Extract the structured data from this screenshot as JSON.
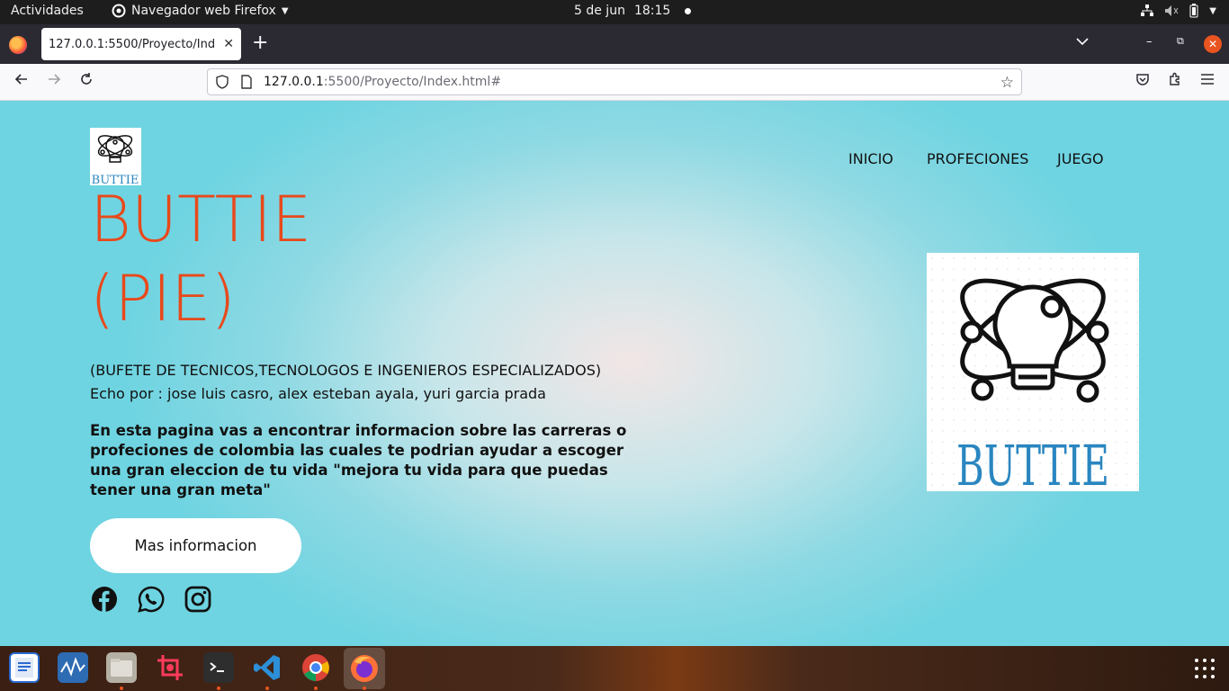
{
  "system_bar": {
    "activities": "Actividades",
    "app_name": "Navegador web Firefox",
    "date": "5 de jun",
    "time": "18:15"
  },
  "browser": {
    "tab_title": "127.0.0.1:5500/Proyecto/Ind",
    "url_host": "127.0.0.1",
    "url_path": ":5500/Proyecto/Index.html#"
  },
  "site": {
    "nav": [
      "INICIO",
      "PROFECIONES",
      "JUEGO"
    ],
    "logo_text": "BUTTIE",
    "title_line1": "BUTTIE",
    "title_line2": "(PIE)",
    "subtitle_line1": "(BUFETE DE TECNICOS,TECNOLOGOS E INGENIEROS ESPECIALIZADOS)",
    "subtitle_line2": "Echo por : jose luis casro, alex esteban ayala, yuri garcia prada",
    "description": "En esta pagina vas a encontrar informacion sobre las carreras o profeciones de colombia las cuales te podrian ayudar a escoger una gran eleccion de tu vida \"mejora tu vida para que puedas tener una gran meta\"",
    "button_label": "Mas informacion",
    "social_icons": [
      "facebook-icon",
      "whatsapp-icon",
      "instagram-icon"
    ]
  },
  "dock": {
    "apps": [
      "libreoffice-writer-icon",
      "system-monitor-icon",
      "files-icon",
      "screenshot-icon",
      "terminal-icon",
      "vscode-icon",
      "chrome-icon",
      "firefox-icon"
    ]
  },
  "colors": {
    "title": "#e8491b",
    "accent": "#e95420",
    "page_bg": "#6fd4e1",
    "logo_blue": "#2a86c0"
  }
}
